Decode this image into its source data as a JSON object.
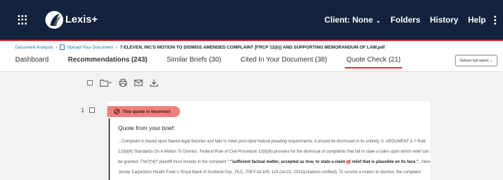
{
  "app": {
    "brand": "Lexis+"
  },
  "nav": {
    "client_label": "Client: None",
    "folders": "Folders",
    "history": "History",
    "help": "Help"
  },
  "breadcrumb": {
    "item1": "Document Analysis",
    "item2": "Upload Your Document",
    "current": "7-ELEVEN, INC'S MOTION TO DISMISS AMENDED COMPLAINT [FRCP 12(b)] AND SUPPORTING MEMORANDUM OF LAW.pdf"
  },
  "tabs": [
    {
      "label": "Dashboard"
    },
    {
      "label": "Recommendations (243)"
    },
    {
      "label": "Similar Briefs (30)"
    },
    {
      "label": "Cited In Your Document (38)"
    },
    {
      "label": "Quote Check (21)"
    }
  ],
  "deliver_button": "Deliver full report",
  "result": {
    "number": "1",
    "status": "This quote is Incorrect",
    "quote_title": "Quote from your brief:",
    "quote_part1": "...Complaint is based upon flawed legal theories and fails to meet post-Iqbal federal pleading requirements, it should be dismissed in its entirety. II. ARGUMENT A.? Rule 12(b)(6) Standards On A Motion To Dismiss. Federal Rule of Civil Procedure 12(b)(6) provides for the dismissal of complaints that fail to state a claim upon which relief can be granted. The?[*4]? plaintiff must include in the complaint \" ",
    "quote_bold1": "\"sufficient factual matter, accepted as true, to state a claim ",
    "quote_hl": "of",
    "quote_bold2": " relief that is plausible on its face.\"",
    "quote_part2": "...New Jersey Carpenters Health Fund v. Royal Bank of Scotland Grp., PLC, 709 F.3d 109, 119 (2d Cir. 2013)(citations omitted). To survive a motion to dismiss, the complaint must articulate \"enough facts to state a claim to relief that is plausible on its face.\""
  },
  "colors": {
    "navbar": "#13233d",
    "accent_red": "#c9303a",
    "incorrect_pill": "#f07f7b"
  }
}
